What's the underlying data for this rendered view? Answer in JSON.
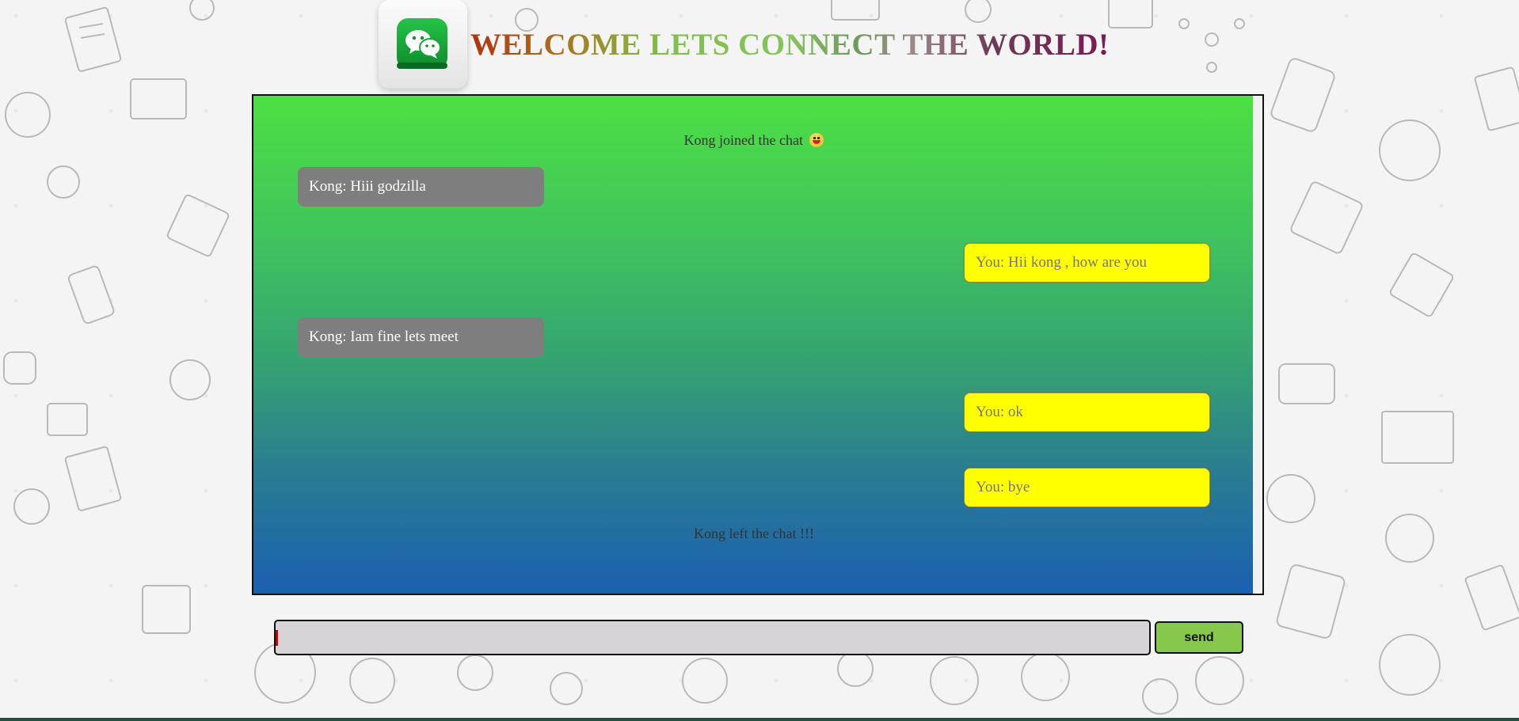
{
  "header": {
    "title": "WELCOME LETS CONNECT THE WORLD!",
    "logo_icon": "chat-bubbles-app-icon"
  },
  "chat": {
    "joined_notice": "Kong joined the chat",
    "joined_emoji": "grinning-face-icon",
    "messages": [
      {
        "side": "them",
        "text": "Kong: Hiii godzilla"
      },
      {
        "side": "you",
        "text": "You: Hii kong , how are you"
      },
      {
        "side": "them",
        "text": "Kong: Iam fine lets meet"
      },
      {
        "side": "you",
        "text": "You: ok"
      },
      {
        "side": "you",
        "text": "You: bye"
      }
    ],
    "left_notice": "Kong left the chat !!!"
  },
  "composer": {
    "input_value": "",
    "send_label": "send"
  },
  "colors": {
    "them_bubble": "#7e7e7e",
    "you_bubble": "#ffff00",
    "send_button": "#86c84b",
    "chat_gradient_top": "#4de043",
    "chat_gradient_bottom": "#1b5fb0"
  }
}
